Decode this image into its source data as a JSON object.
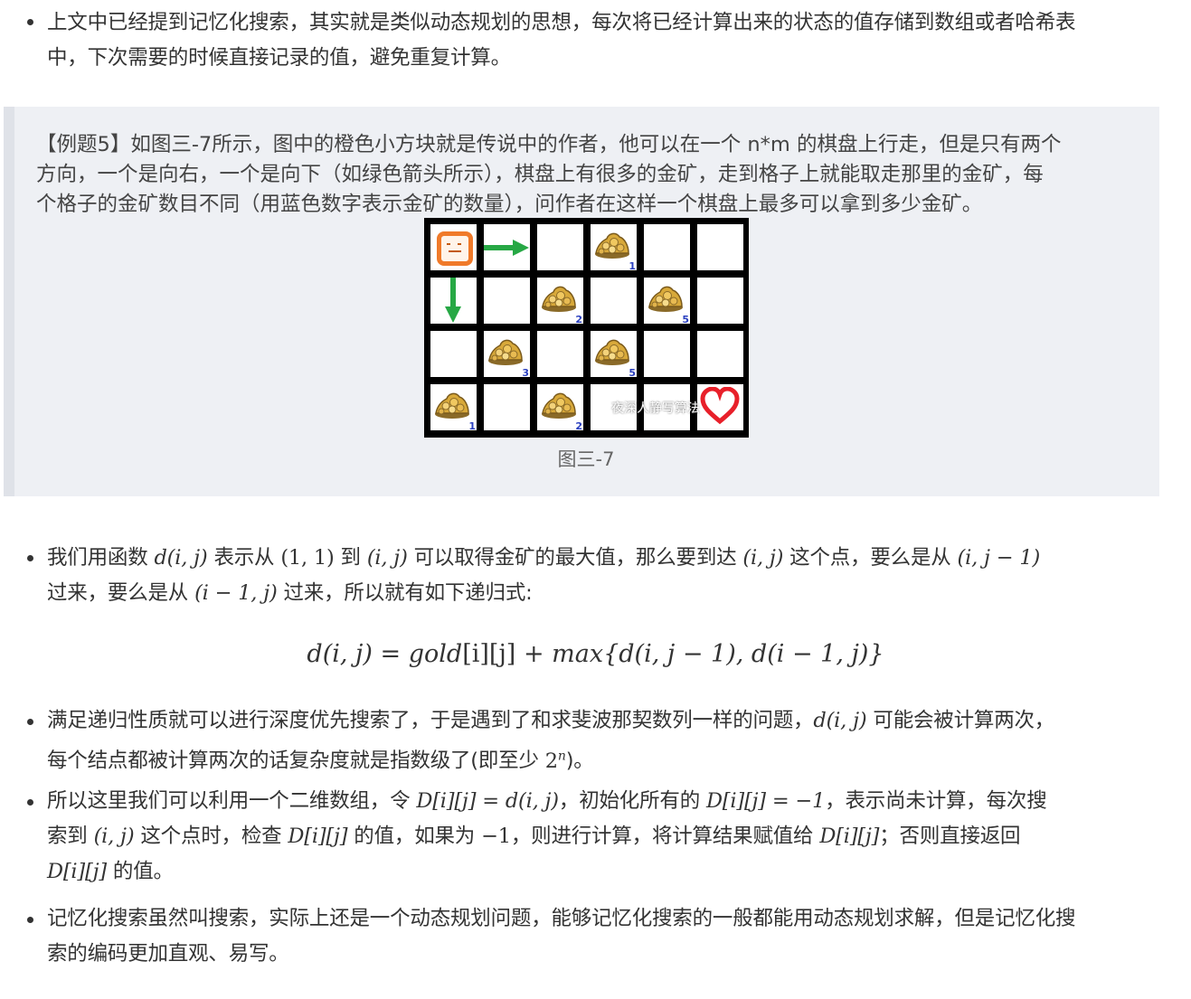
{
  "intro": {
    "line1": "上文中已经提到记忆化搜索，其实就是类似动态规划的思想，每次将已经计算出来的状态的值存储到数组或者哈希表",
    "line2": "中，下次需要的时候直接记录的值，避免重复计算。"
  },
  "example": {
    "line1": "【例题5】如图三-7所示，图中的橙色小方块就是传说中的作者，他可以在一个 n*m 的棋盘上行走，但是只有两个",
    "line2": "方向，一个是向右，一个是向下（如绿色箭头所示），棋盘上有很多的金矿，走到格子上就能取走那里的金矿，每",
    "line3": "个格子的金矿数目不同（用蓝色数字表示金矿的数量），问作者在这样一个棋盘上最多可以拿到多少金矿。",
    "figure": {
      "caption": "图三-7",
      "watermark": "夜深人静写算法",
      "gold": [
        {
          "row": 0,
          "col": 3,
          "count": "1"
        },
        {
          "row": 1,
          "col": 2,
          "count": "2"
        },
        {
          "row": 1,
          "col": 4,
          "count": "5"
        },
        {
          "row": 2,
          "col": 1,
          "count": "3"
        },
        {
          "row": 2,
          "col": 3,
          "count": "5"
        },
        {
          "row": 3,
          "col": 0,
          "count": "1"
        },
        {
          "row": 3,
          "col": 2,
          "count": "2"
        }
      ],
      "colors": {
        "player": "#f07a2a",
        "arrow": "#27a845",
        "heart": "#e8202a",
        "count": "#2a3fbf"
      }
    }
  },
  "bullet1": {
    "t1": "我们用函数 ",
    "t2": " 表示从 ",
    "t3": " 到 ",
    "t4": " 可以取得金矿的最大值，那么要到达 ",
    "t5": " 这个点，要么是从 ",
    "t6": "过来，要么是从 ",
    "t7": " 过来，所以就有如下递归式:",
    "m1": "d(i, j)",
    "m2": "(1, 1)",
    "m3": "(i, j)",
    "m4": "(i, j)",
    "m5": "(i, j − 1)",
    "m6": "(i − 1, j)"
  },
  "formula": {
    "lhs": "d(i, j) = gold",
    "idx": "[i][j]",
    "rhs": " + max{d(i, j − 1), d(i − 1, j)}"
  },
  "bullet2": {
    "t1": "满足递归性质就可以进行深度优先搜索了，于是遇到了和求斐波那契数列一样的问题，",
    "m1": "d(i, j)",
    "t2": " 可能会被计算两次，",
    "t3": "每个结点都被计算两次的话复杂度就是指数级了(即至少 ",
    "m2base": "2",
    "m2exp": "n",
    "t4": ")。"
  },
  "bullet3": {
    "t1": "所以这里我们可以利用一个二维数组，令 ",
    "m1": "D[i][j] = d(i, j)",
    "t2": "，初始化所有的 ",
    "m2": "D[i][j] = −1",
    "t3": "，表示尚未计算，每次搜",
    "t4": "索到 ",
    "m3": "(i, j)",
    "t5": " 这个点时，检查 ",
    "m4": "D[i][j]",
    "t6": " 的值，如果为 ",
    "m5": "−1",
    "t7": "，则进行计算，将计算结果赋值给 ",
    "m6": "D[i][j]",
    "t8": "；否则直接返回",
    "m7": "D[i][j]",
    "t9": " 的值。"
  },
  "bullet4": {
    "line1": "记忆化搜索虽然叫搜索，实际上还是一个动态规划问题，能够记忆化搜索的一般都能用动态规划求解，但是记忆化搜",
    "line2": "索的编码更加直观、易写。"
  }
}
